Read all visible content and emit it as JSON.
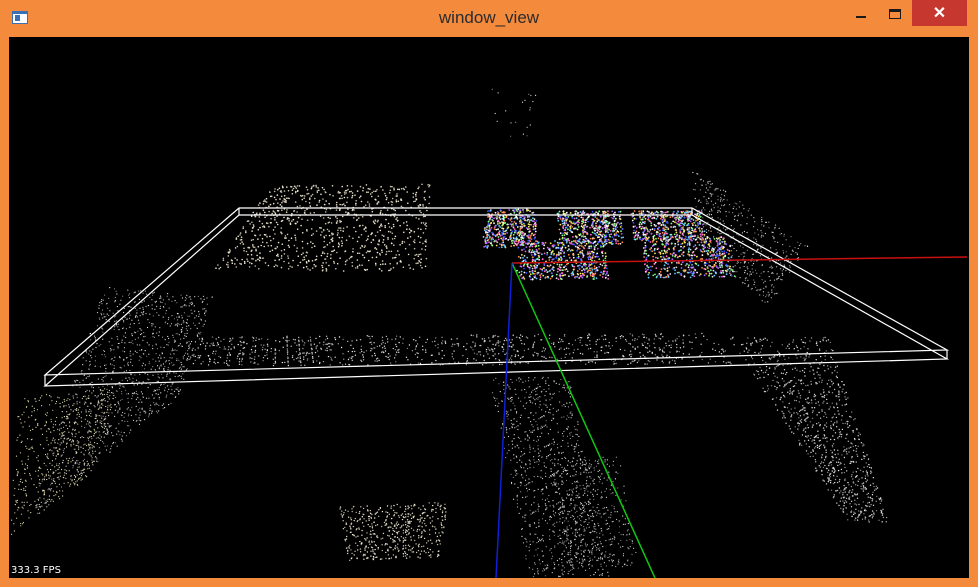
{
  "window": {
    "title": "window_view",
    "close_symbol": "✕"
  },
  "viewer": {
    "fps_label": "333.3 FPS",
    "axis_colors": {
      "x": "#c81010",
      "y": "#10c810",
      "z": "#1020d8"
    },
    "box_color": "#ffffff"
  }
}
